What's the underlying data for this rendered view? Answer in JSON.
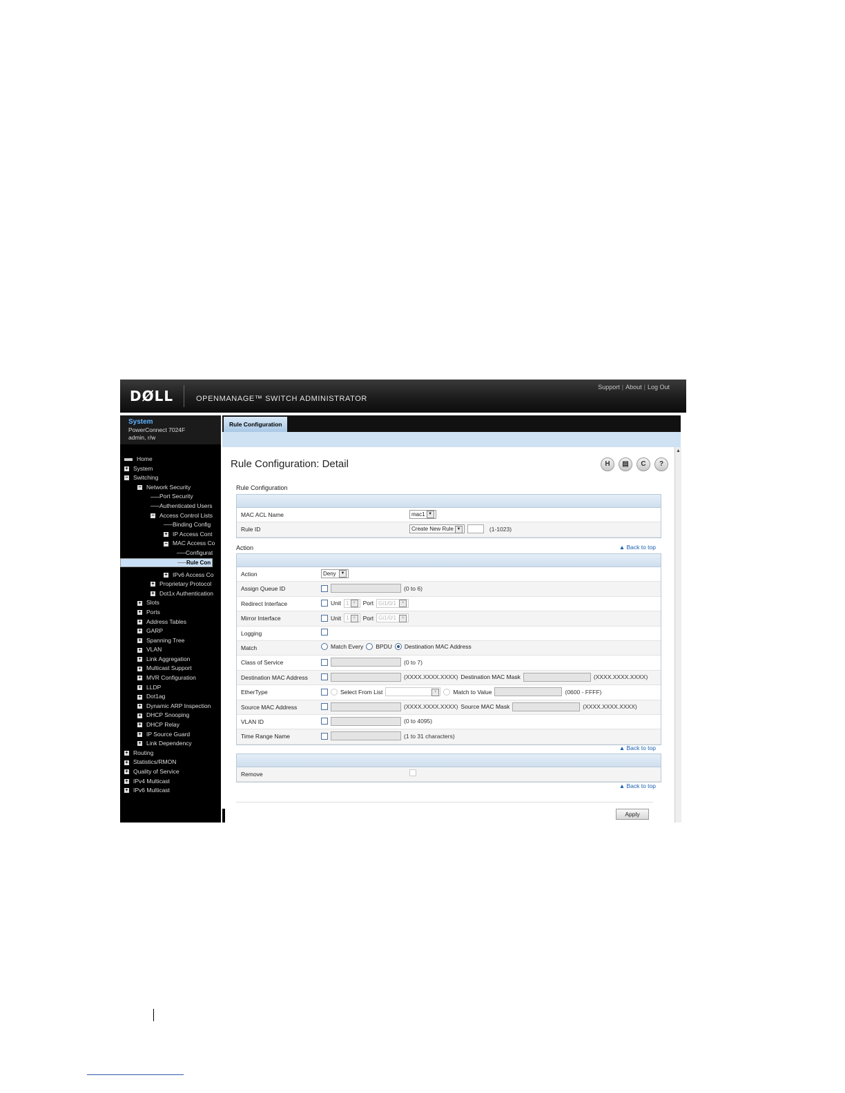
{
  "header": {
    "logo": "DØLL",
    "product": "OPENMANAGE™ SWITCH ADMINISTRATOR",
    "links": [
      "Support",
      "About",
      "Log Out"
    ]
  },
  "system": {
    "title": "System",
    "model": "PowerConnect 7024F",
    "user": "admin, r/w"
  },
  "tree": [
    {
      "label": "Home",
      "indent": 0,
      "icon": "home"
    },
    {
      "label": "System",
      "indent": 0,
      "icon": "plus"
    },
    {
      "label": "Switching",
      "indent": 0,
      "icon": "minus"
    },
    {
      "label": "Network Security",
      "indent": 1,
      "icon": "minus"
    },
    {
      "label": "Port Security",
      "indent": 2,
      "icon": "line"
    },
    {
      "label": "Authenticated Users",
      "indent": 2,
      "icon": "line"
    },
    {
      "label": "Access Control Lists",
      "indent": 2,
      "icon": "minus"
    },
    {
      "label": "Binding Config",
      "indent": 3,
      "icon": "line"
    },
    {
      "label": "IP Access Cont",
      "indent": 3,
      "icon": "plus"
    },
    {
      "label": "MAC Access Co",
      "indent": 3,
      "icon": "minus"
    },
    {
      "label": "Configurat",
      "indent": 4,
      "icon": "line"
    },
    {
      "label": "Rule Con",
      "indent": 4,
      "icon": "line",
      "selected": true
    },
    {
      "label": "IPv6 Access Co",
      "indent": 3,
      "icon": "plus"
    },
    {
      "label": "Proprietary Protocol",
      "indent": 2,
      "icon": "plus"
    },
    {
      "label": "Dot1x Authentication",
      "indent": 2,
      "icon": "plus"
    },
    {
      "label": "Slots",
      "indent": 1,
      "icon": "plus"
    },
    {
      "label": "Ports",
      "indent": 1,
      "icon": "plus"
    },
    {
      "label": "Address Tables",
      "indent": 1,
      "icon": "plus"
    },
    {
      "label": "GARP",
      "indent": 1,
      "icon": "plus"
    },
    {
      "label": "Spanning Tree",
      "indent": 1,
      "icon": "plus"
    },
    {
      "label": "VLAN",
      "indent": 1,
      "icon": "plus"
    },
    {
      "label": "Link Aggregation",
      "indent": 1,
      "icon": "plus"
    },
    {
      "label": "Multicast Support",
      "indent": 1,
      "icon": "plus"
    },
    {
      "label": "MVR Configuration",
      "indent": 1,
      "icon": "plus"
    },
    {
      "label": "LLDP",
      "indent": 1,
      "icon": "plus"
    },
    {
      "label": "Dot1ag",
      "indent": 1,
      "icon": "plus"
    },
    {
      "label": "Dynamic ARP Inspection",
      "indent": 1,
      "icon": "plus"
    },
    {
      "label": "DHCP Snooping",
      "indent": 1,
      "icon": "plus"
    },
    {
      "label": "DHCP Relay",
      "indent": 1,
      "icon": "plus"
    },
    {
      "label": "IP Source Guard",
      "indent": 1,
      "icon": "plus"
    },
    {
      "label": "Link Dependency",
      "indent": 1,
      "icon": "plus"
    },
    {
      "label": "Routing",
      "indent": 0,
      "icon": "plus"
    },
    {
      "label": "Statistics/RMON",
      "indent": 0,
      "icon": "plus"
    },
    {
      "label": "Quality of Service",
      "indent": 0,
      "icon": "plus"
    },
    {
      "label": "IPv4 Multicast",
      "indent": 0,
      "icon": "plus"
    },
    {
      "label": "IPv6 Multicast",
      "indent": 0,
      "icon": "plus"
    }
  ],
  "tab": {
    "label": "Rule Configuration"
  },
  "page": {
    "title": "Rule Configuration: Detail",
    "back_to_top": "Back to top",
    "apply": "Apply"
  },
  "rule_config": {
    "section": "Rule Configuration",
    "acl_name_label": "MAC ACL Name",
    "acl_name_value": "mac1",
    "rule_id_label": "Rule ID",
    "rule_id_value": "Create New Rule",
    "rule_id_hint": "(1-1023)"
  },
  "action": {
    "section": "Action",
    "action_label": "Action",
    "action_value": "Deny",
    "queue_label": "Assign Queue ID",
    "queue_hint": "(0 to 6)",
    "redirect_label": "Redirect Interface",
    "mirror_label": "Mirror Interface",
    "unit_label": "Unit",
    "unit_value": "1",
    "port_label": "Port",
    "port_value": "Gi1/0/1",
    "logging_label": "Logging",
    "match_label": "Match",
    "match_every": "Match Every",
    "match_bpdu": "BPDU",
    "match_dest": "Destination MAC Address",
    "cos_label": "Class of Service",
    "cos_hint": "(0 to 7)",
    "dmac_label": "Destination MAC Address",
    "mac_hint": "(XXXX.XXXX.XXXX)",
    "dmask_label": "Destination MAC Mask",
    "ethertype_label": "EtherType",
    "select_from_list": "Select From List",
    "match_to_value": "Match to Value",
    "ethertype_hint": "(0600 - FFFF)",
    "smac_label": "Source MAC Address",
    "smask_label": "Source MAC Mask",
    "vlan_label": "VLAN ID",
    "vlan_hint": "(0 to 4095)",
    "time_label": "Time Range Name",
    "time_hint": "(1 to 31 characters)"
  },
  "remove": {
    "label": "Remove"
  }
}
